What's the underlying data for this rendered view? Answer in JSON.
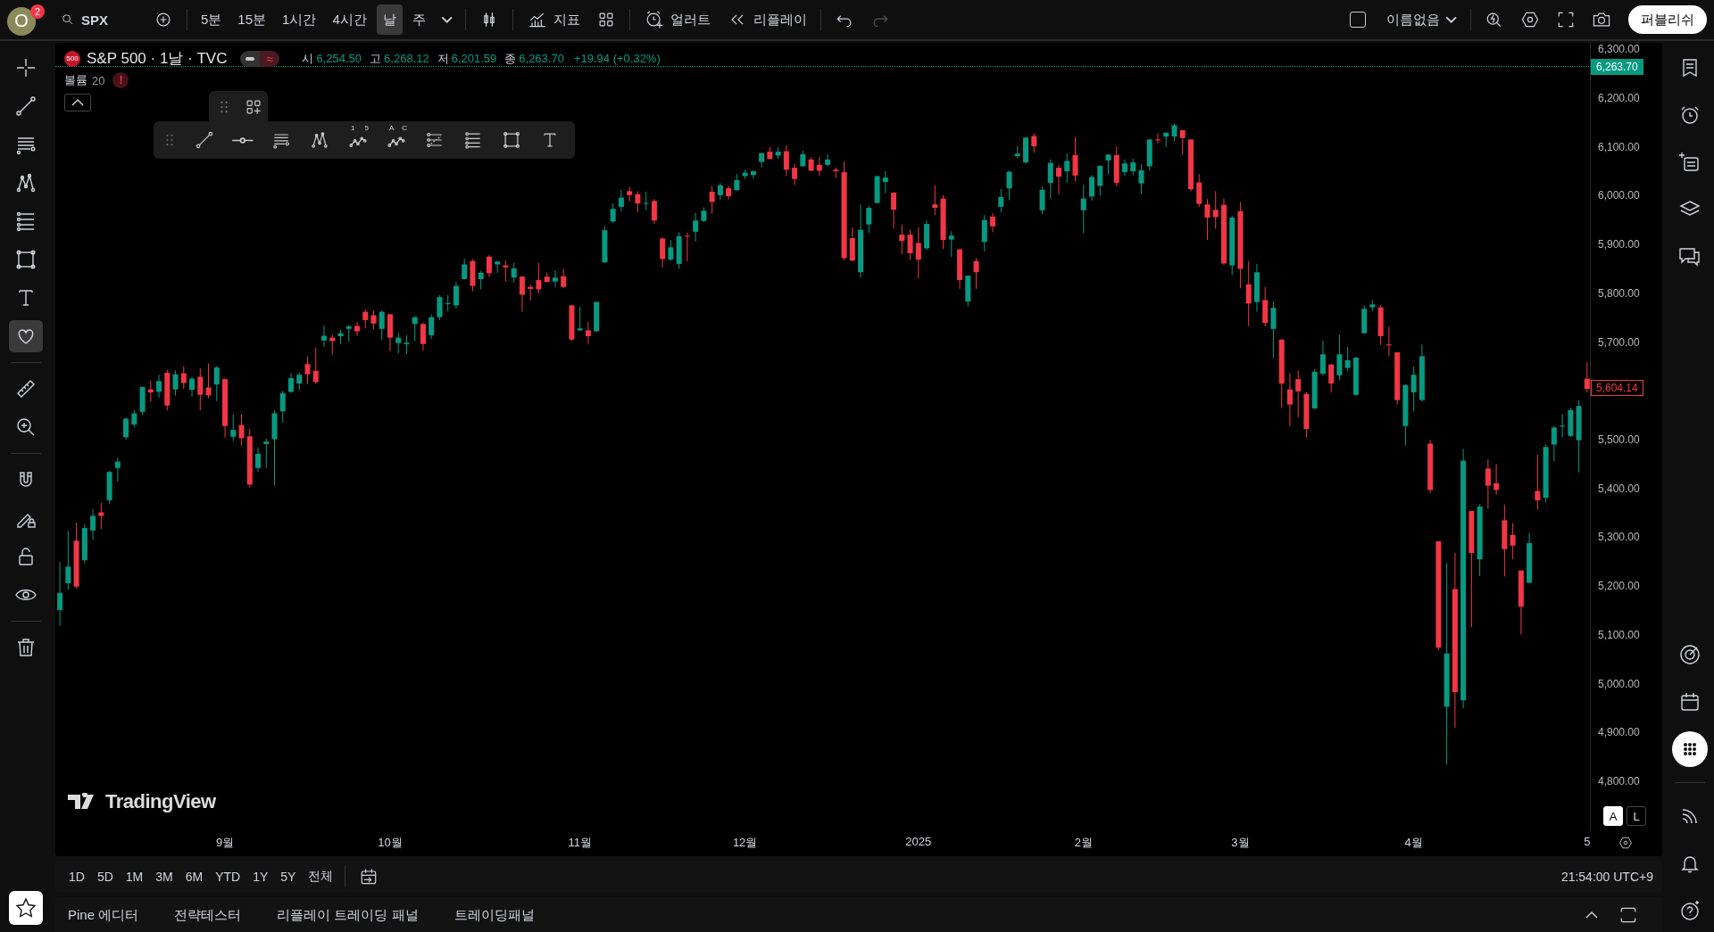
{
  "top_bar": {
    "avatar": {
      "letter": "O",
      "badge": "2"
    },
    "symbol_search": {
      "value": "SPX"
    },
    "intervals": [
      {
        "label": "5분",
        "selected": false
      },
      {
        "label": "15분",
        "selected": false
      },
      {
        "label": "1시간",
        "selected": false
      },
      {
        "label": "4시간",
        "selected": false
      },
      {
        "label": "날",
        "selected": true
      },
      {
        "label": "주",
        "selected": false
      }
    ],
    "indicators_button": "지표",
    "alert_button": "얼러트",
    "replay_button": "리플레이",
    "redo": {
      "disabled": true
    },
    "layout_checkbox": {
      "checked": false
    },
    "layout_name": "이름없음",
    "publish_button": "퍼블리쉬"
  },
  "left_toolbar": {
    "tools": [
      {
        "kind": "crosshair",
        "selected": false
      },
      {
        "kind": "trend-line",
        "selected": false
      },
      {
        "kind": "horizontal-lines",
        "selected": false
      },
      {
        "kind": "pattern",
        "selected": false
      },
      {
        "kind": "fib-lines",
        "selected": false
      },
      {
        "kind": "rectangle",
        "selected": false
      },
      {
        "kind": "text-tool",
        "selected": false
      },
      {
        "kind": "heart",
        "selected": true
      },
      {
        "kind": "ruler",
        "selected": false
      },
      {
        "kind": "zoom-in",
        "selected": false
      },
      {
        "kind": "magnet",
        "selected": false
      },
      {
        "kind": "pencil-lock",
        "selected": false
      },
      {
        "kind": "lock",
        "selected": false
      },
      {
        "kind": "eye",
        "selected": false
      },
      {
        "kind": "trash",
        "selected": false
      }
    ]
  },
  "legend": {
    "symbol_badge": "500",
    "title": "S&P 500 · 1날 · TVC",
    "toggle_glyph": "≈",
    "ohlc": [
      {
        "label": "시",
        "value": "6,254.50"
      },
      {
        "label": "고",
        "value": "6,268.12"
      },
      {
        "label": "저",
        "value": "6,201.59"
      },
      {
        "label": "종",
        "value": "6,263.70"
      }
    ],
    "change": "+19.94 (+0.32%)",
    "volume": {
      "label": "볼륨",
      "value": "20",
      "warning": "!"
    }
  },
  "drawing_toolbar": {
    "tools": [
      {
        "kind": "trend-line"
      },
      {
        "kind": "horizontal-ray"
      },
      {
        "kind": "horizontal-lines"
      },
      {
        "kind": "pattern"
      },
      {
        "kind": "wave",
        "marks": [
          "1",
          "5"
        ]
      },
      {
        "kind": "wave",
        "marks": [
          "A",
          "C"
        ]
      },
      {
        "kind": "fib-trend"
      },
      {
        "kind": "fib-lines"
      },
      {
        "kind": "rectangle"
      },
      {
        "kind": "text-tool"
      }
    ]
  },
  "chart_data": {
    "type": "candlestick",
    "categories": [
      null,
      null,
      null,
      null,
      null,
      null,
      null,
      null,
      null,
      null,
      null,
      null,
      null,
      null,
      null,
      null,
      null,
      null,
      null,
      null,
      "9월",
      null,
      null,
      null,
      null,
      null,
      null,
      null,
      null,
      null,
      null,
      null,
      null,
      null,
      null,
      null,
      null,
      null,
      null,
      null,
      "10월",
      null,
      null,
      null,
      null,
      null,
      null,
      null,
      null,
      null,
      null,
      null,
      null,
      null,
      null,
      null,
      null,
      null,
      null,
      null,
      null,
      null,
      null,
      "11월",
      null,
      null,
      null,
      null,
      null,
      null,
      null,
      null,
      null,
      null,
      null,
      null,
      null,
      null,
      null,
      null,
      null,
      null,
      null,
      "12월",
      null,
      null,
      null,
      null,
      null,
      null,
      null,
      null,
      null,
      null,
      null,
      null,
      null,
      null,
      null,
      null,
      null,
      null,
      null,
      null,
      "2025",
      null,
      null,
      null,
      null,
      null,
      null,
      null,
      null,
      null,
      null,
      null,
      null,
      null,
      null,
      null,
      null,
      null,
      null,
      null,
      "2월",
      null,
      null,
      null,
      null,
      null,
      null,
      null,
      null,
      null,
      null,
      null,
      null,
      null,
      null,
      null,
      null,
      null,
      null,
      "3월",
      null,
      null,
      null,
      null,
      null,
      null,
      null,
      null,
      null,
      null,
      null,
      null,
      null,
      null,
      null,
      null,
      null,
      null,
      null,
      null,
      "4월",
      null,
      null,
      null,
      null,
      null,
      null,
      null,
      null,
      null,
      null,
      null,
      null,
      null,
      null,
      null,
      null,
      null,
      null,
      null,
      null,
      "5"
    ],
    "ohlc": [
      [
        5151,
        5250,
        5119,
        5186
      ],
      [
        5206,
        5313,
        5193,
        5240
      ],
      [
        5293,
        5330,
        5195,
        5199
      ],
      [
        5253,
        5327,
        5247,
        5319
      ],
      [
        5314,
        5358,
        5295,
        5344
      ],
      [
        5351,
        5371,
        5317,
        5344
      ],
      [
        5376,
        5436,
        5369,
        5434
      ],
      [
        5442,
        5463,
        5414,
        5455
      ],
      [
        5505,
        5546,
        5500,
        5543
      ],
      [
        5531,
        5561,
        5525,
        5554
      ],
      [
        5557,
        5609,
        5550,
        5608
      ],
      [
        5603,
        5621,
        5578,
        5597
      ],
      [
        5598,
        5633,
        5586,
        5620
      ],
      [
        5637,
        5643,
        5560,
        5570
      ],
      [
        5603,
        5642,
        5590,
        5634
      ],
      [
        5636,
        5651,
        5604,
        5616
      ],
      [
        5602,
        5628,
        5588,
        5625
      ],
      [
        5629,
        5646,
        5560,
        5592
      ],
      [
        5607,
        5656,
        5585,
        5591
      ],
      [
        5613,
        5651,
        5579,
        5648
      ],
      [
        5624,
        5626,
        5504,
        5528
      ],
      [
        5506,
        5552,
        5497,
        5520
      ],
      [
        5530,
        5552,
        5488,
        5503
      ],
      [
        5507,
        5522,
        5402,
        5408
      ],
      [
        5442,
        5484,
        5434,
        5471
      ],
      [
        5491,
        5502,
        5442,
        5496
      ],
      [
        5501,
        5560,
        5406,
        5554
      ],
      [
        5558,
        5600,
        5535,
        5595
      ],
      [
        5598,
        5636,
        5596,
        5626
      ],
      [
        5615,
        5637,
        5602,
        5633
      ],
      [
        5655,
        5670,
        5614,
        5634
      ],
      [
        5641,
        5689,
        5615,
        5618
      ],
      [
        5703,
        5734,
        5690,
        5713
      ],
      [
        5709,
        5715,
        5674,
        5702
      ],
      [
        5712,
        5725,
        5696,
        5718
      ],
      [
        5727,
        5735,
        5701,
        5732
      ],
      [
        5733,
        5741,
        5713,
        5722
      ],
      [
        5762,
        5767,
        5728,
        5745
      ],
      [
        5755,
        5765,
        5726,
        5738
      ],
      [
        5727,
        5765,
        5704,
        5762
      ],
      [
        5757,
        5757,
        5681,
        5709
      ],
      [
        5698,
        5719,
        5677,
        5709
      ],
      [
        5696,
        5714,
        5675,
        5699
      ],
      [
        5737,
        5753,
        5702,
        5751
      ],
      [
        5737,
        5740,
        5683,
        5696
      ],
      [
        5714,
        5757,
        5706,
        5751
      ],
      [
        5751,
        5796,
        5745,
        5792
      ],
      [
        5778,
        5796,
        5763,
        5780
      ],
      [
        5775,
        5823,
        5769,
        5815
      ],
      [
        5829,
        5871,
        5829,
        5859
      ],
      [
        5866,
        5870,
        5804,
        5815
      ],
      [
        5829,
        5846,
        5808,
        5842
      ],
      [
        5875,
        5878,
        5833,
        5841
      ],
      [
        5859,
        5866,
        5842,
        5865
      ],
      [
        5857,
        5867,
        5825,
        5853
      ],
      [
        5832,
        5863,
        5822,
        5851
      ],
      [
        5834,
        5835,
        5762,
        5797
      ],
      [
        5813,
        5818,
        5785,
        5809
      ],
      [
        5827,
        5862,
        5800,
        5808
      ],
      [
        5834,
        5842,
        5823,
        5823
      ],
      [
        5824,
        5847,
        5813,
        5832
      ],
      [
        5835,
        5850,
        5810,
        5813
      ],
      [
        5775,
        5776,
        5703,
        5705
      ],
      [
        5724,
        5772,
        5723,
        5728
      ],
      [
        5724,
        5741,
        5696,
        5712
      ],
      [
        5722,
        5783,
        5722,
        5782
      ],
      [
        5863,
        5937,
        5863,
        5929
      ],
      [
        5947,
        5984,
        5944,
        5973
      ],
      [
        5977,
        6012,
        5968,
        5996
      ],
      [
        6009,
        6018,
        5988,
        6001
      ],
      [
        6003,
        6009,
        5966,
        5984
      ],
      [
        5985,
        6008,
        5970,
        5985
      ],
      [
        5989,
        5993,
        5942,
        5949
      ],
      [
        5912,
        5915,
        5853,
        5870
      ],
      [
        5869,
        5909,
        5866,
        5894
      ],
      [
        5860,
        5925,
        5850,
        5917
      ],
      [
        5918,
        5924,
        5866,
        5917
      ],
      [
        5926,
        5965,
        5906,
        5949
      ],
      [
        5948,
        5976,
        5946,
        5969
      ],
      [
        6008,
        6020,
        5963,
        5987
      ],
      [
        6001,
        6025,
        5992,
        6021
      ],
      [
        6015,
        6020,
        5992,
        5999
      ],
      [
        6011,
        6044,
        6011,
        6032
      ],
      [
        6040,
        6053,
        6034,
        6047
      ],
      [
        6042,
        6052,
        6034,
        6050
      ],
      [
        6069,
        6087,
        6058,
        6087
      ],
      [
        6090,
        6100,
        6075,
        6075
      ],
      [
        6082,
        6099,
        6075,
        6090
      ],
      [
        6091,
        6103,
        6040,
        6053
      ],
      [
        6057,
        6065,
        6022,
        6034
      ],
      [
        6060,
        6092,
        6060,
        6085
      ],
      [
        6074,
        6079,
        6051,
        6051
      ],
      [
        6063,
        6079,
        6040,
        6051
      ],
      [
        6063,
        6085,
        6059,
        6074
      ],
      [
        6053,
        6057,
        6036,
        6050
      ],
      [
        6048,
        6070,
        5867,
        5872
      ],
      [
        5913,
        5935,
        5865,
        5867
      ],
      [
        5843,
        5982,
        5832,
        5930
      ],
      [
        5941,
        5979,
        5924,
        5975
      ],
      [
        5985,
        6041,
        5984,
        6040
      ],
      [
        6028,
        6050,
        6005,
        6037
      ],
      [
        6006,
        6007,
        5932,
        5971
      ],
      [
        5920,
        5941,
        5880,
        5907
      ],
      [
        5920,
        5930,
        5868,
        5882
      ],
      [
        5903,
        5935,
        5830,
        5869
      ],
      [
        5892,
        5949,
        5888,
        5942
      ],
      [
        5982,
        6021,
        5960,
        5975
      ],
      [
        5994,
        6001,
        5891,
        5909
      ],
      [
        5910,
        5927,
        5874,
        5918
      ],
      [
        5890,
        5890,
        5809,
        5827
      ],
      [
        5783,
        5836,
        5773,
        5836
      ],
      [
        5866,
        5872,
        5809,
        5843
      ],
      [
        5905,
        5960,
        5886,
        5950
      ],
      [
        5957,
        5964,
        5925,
        5937
      ],
      [
        5977,
        6014,
        5966,
        5997
      ],
      [
        6015,
        6051,
        5991,
        6049
      ],
      [
        6081,
        6101,
        6076,
        6086
      ],
      [
        6068,
        6119,
        6065,
        6119
      ],
      [
        6122,
        6128,
        6088,
        6101
      ],
      [
        5970,
        6018,
        5962,
        6012
      ],
      [
        6026,
        6074,
        5994,
        6067
      ],
      [
        6057,
        6063,
        6002,
        6039
      ],
      [
        6050,
        6086,
        6027,
        6071
      ],
      [
        6083,
        6120,
        6030,
        6041
      ],
      [
        5970,
        6022,
        5923,
        5994
      ],
      [
        5998,
        6042,
        5990,
        6038
      ],
      [
        6020,
        6062,
        6000,
        6061
      ],
      [
        6072,
        6084,
        6044,
        6084
      ],
      [
        6083,
        6101,
        6020,
        6026
      ],
      [
        6048,
        6074,
        6040,
        6066
      ],
      [
        6050,
        6076,
        6042,
        6068
      ],
      [
        6025,
        6064,
        6003,
        6052
      ],
      [
        6060,
        6116,
        6051,
        6115
      ],
      [
        6115,
        6127,
        6107,
        6114
      ],
      [
        6121,
        6129,
        6099,
        6129
      ],
      [
        6121,
        6147,
        6111,
        6144
      ],
      [
        6134,
        6134,
        6084,
        6118
      ],
      [
        6115,
        6115,
        6009,
        6013
      ],
      [
        6027,
        6044,
        5977,
        5983
      ],
      [
        5982,
        5993,
        5909,
        5955
      ],
      [
        5971,
        6009,
        5932,
        5956
      ],
      [
        5981,
        5994,
        5858,
        5861
      ],
      [
        5857,
        5959,
        5837,
        5955
      ],
      [
        5968,
        5987,
        5810,
        5850
      ],
      [
        5818,
        5866,
        5733,
        5779
      ],
      [
        5782,
        5860,
        5762,
        5843
      ],
      [
        5786,
        5813,
        5732,
        5739
      ],
      [
        5727,
        5783,
        5667,
        5770
      ],
      [
        5705,
        5706,
        5565,
        5615
      ],
      [
        5603,
        5636,
        5528,
        5572
      ],
      [
        5624,
        5642,
        5546,
        5599
      ],
      [
        5594,
        5597,
        5505,
        5522
      ],
      [
        5564,
        5645,
        5563,
        5639
      ],
      [
        5635,
        5703,
        5631,
        5675
      ],
      [
        5654,
        5655,
        5597,
        5615
      ],
      [
        5632,
        5715,
        5622,
        5675
      ],
      [
        5647,
        5690,
        5640,
        5663
      ],
      [
        5592,
        5670,
        5590,
        5668
      ],
      [
        5718,
        5775,
        5718,
        5768
      ],
      [
        5771,
        5786,
        5764,
        5777
      ],
      [
        5771,
        5776,
        5694,
        5712
      ],
      [
        5695,
        5732,
        5671,
        5693
      ],
      [
        5679,
        5679,
        5572,
        5581
      ],
      [
        5528,
        5613,
        5488,
        5612
      ],
      [
        5597,
        5650,
        5558,
        5633
      ],
      [
        5581,
        5695,
        5578,
        5671
      ],
      [
        5492,
        5500,
        5390,
        5397
      ],
      [
        5292,
        5292,
        5069,
        5074
      ],
      [
        4953,
        5247,
        4835,
        5062
      ],
      [
        5194,
        5268,
        4910,
        4983
      ],
      [
        4966,
        5481,
        4950,
        5457
      ],
      [
        5354,
        5354,
        5116,
        5268
      ],
      [
        5255,
        5368,
        5221,
        5363
      ],
      [
        5441,
        5460,
        5359,
        5406
      ],
      [
        5411,
        5450,
        5387,
        5397
      ],
      [
        5335,
        5367,
        5220,
        5276
      ],
      [
        5305,
        5329,
        5255,
        5283
      ],
      [
        5232,
        5232,
        5101,
        5158
      ],
      [
        5207,
        5309,
        5207,
        5288
      ],
      [
        5395,
        5469,
        5357,
        5376
      ],
      [
        5381,
        5490,
        5371,
        5485
      ],
      [
        5490,
        5528,
        5455,
        5525
      ],
      [
        5529,
        5553,
        5505,
        5529
      ],
      [
        5508,
        5565,
        5505,
        5561
      ],
      [
        5499,
        5581,
        5433,
        5569
      ],
      [
        5625,
        5658,
        5597,
        5604
      ]
    ],
    "ylim": [
      4698,
      6313
    ],
    "yticks": [
      {
        "value": 6300,
        "label": "6,300.00"
      },
      {
        "value": 6200,
        "label": "6,200.00"
      },
      {
        "value": 6100,
        "label": "6,100.00"
      },
      {
        "value": 6000,
        "label": "6,000.00"
      },
      {
        "value": 5900,
        "label": "5,900.00"
      },
      {
        "value": 5800,
        "label": "5,800.00"
      },
      {
        "value": 5700,
        "label": "5,700.00"
      },
      {
        "value": 5500,
        "label": "5,500.00"
      },
      {
        "value": 5400,
        "label": "5,400.00"
      },
      {
        "value": 5300,
        "label": "5,300.00"
      },
      {
        "value": 5200,
        "label": "5,200.00"
      },
      {
        "value": 5100,
        "label": "5,100.00"
      },
      {
        "value": 5000,
        "label": "5,000.00"
      },
      {
        "value": 4900,
        "label": "4,900.00"
      },
      {
        "value": 4800,
        "label": "4,800.00"
      }
    ]
  },
  "price_axis": {
    "last_price": "6,263.70",
    "current_price": "5,604.14"
  },
  "logo": "TradingView",
  "scale_toggles": [
    {
      "label": "A",
      "selected": true
    },
    {
      "label": "L",
      "selected": false
    }
  ],
  "range_bar": {
    "ranges": [
      "1D",
      "5D",
      "1M",
      "3M",
      "6M",
      "YTD",
      "1Y",
      "5Y",
      "전체"
    ],
    "clock": "21:54:00 UTC+9"
  },
  "bottom_panel": {
    "tabs": [
      "Pine 에디터",
      "전략테스터",
      "리플레이 트레이딩 패널",
      "트레이딩패널"
    ]
  },
  "right_toolbar": {
    "tools": [
      {
        "kind": "watchlist",
        "selected": false
      },
      {
        "kind": "alarm-clock",
        "selected": false
      },
      {
        "kind": "add-list",
        "selected": false
      },
      {
        "kind": "layers",
        "selected": false
      },
      {
        "kind": "chat",
        "selected": false
      },
      {
        "kind": "target",
        "selected": false
      },
      {
        "kind": "calendar",
        "selected": false
      },
      {
        "kind": "dot-grid",
        "selected": true
      },
      {
        "kind": "stream",
        "selected": false
      },
      {
        "kind": "bell",
        "selected": false
      },
      {
        "kind": "help",
        "selected": false
      }
    ]
  }
}
